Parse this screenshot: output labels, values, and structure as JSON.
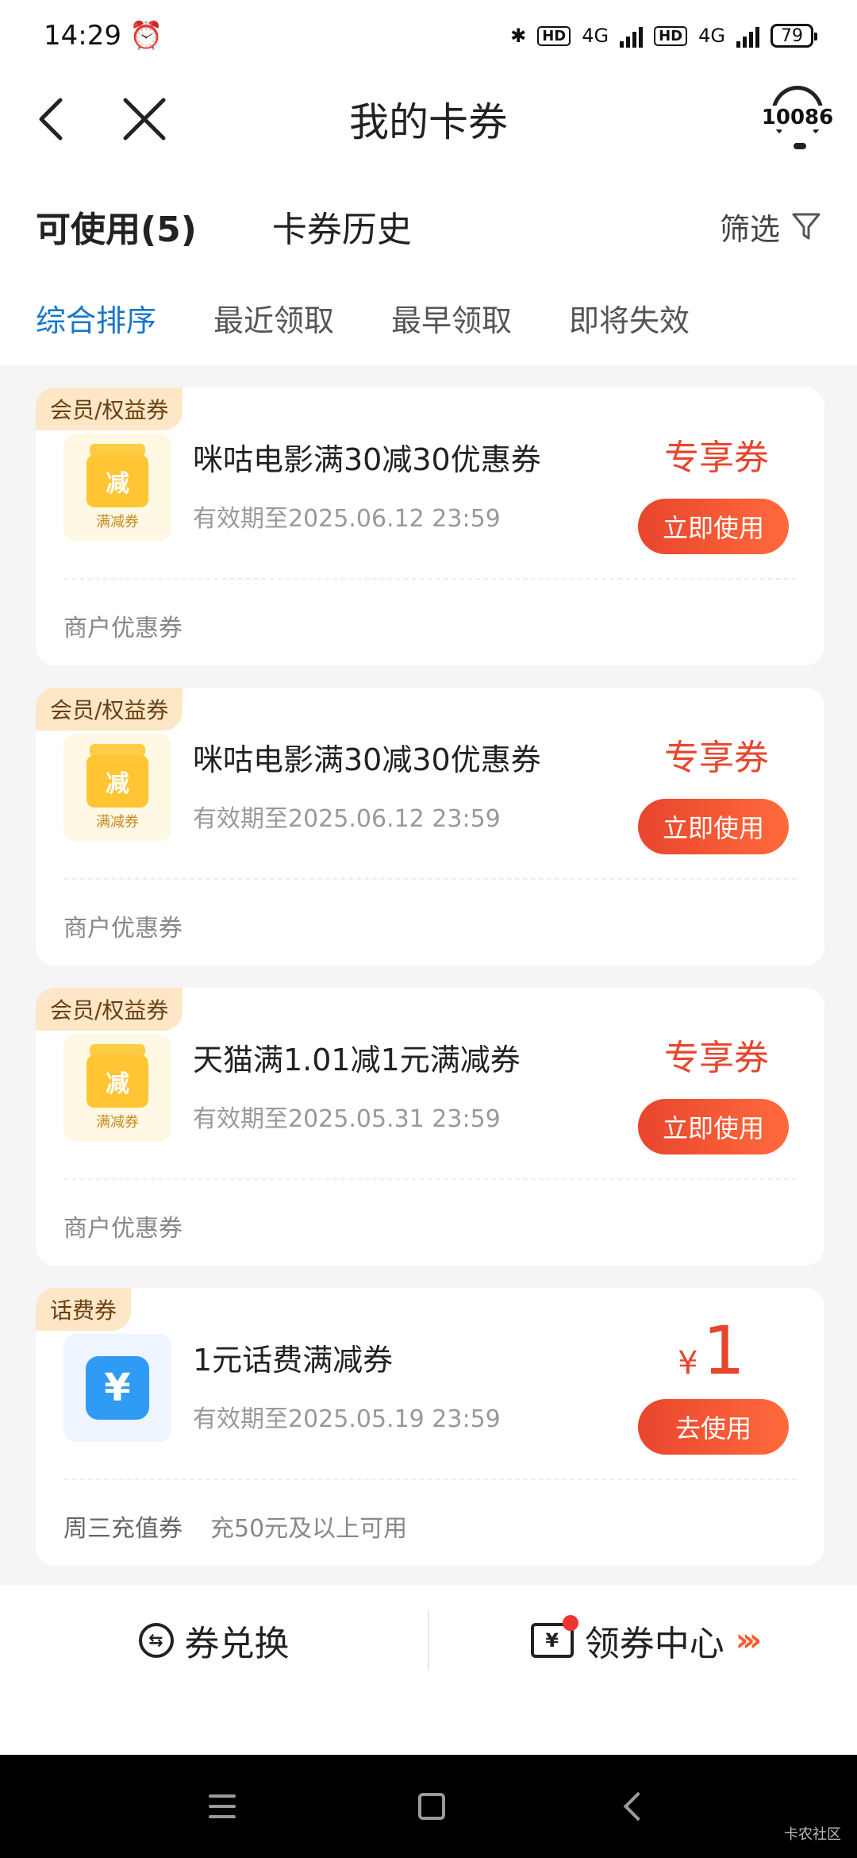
{
  "status_bar": {
    "time": "14:29",
    "network1": "4G",
    "network2": "4G",
    "hd": "HD",
    "battery": "79"
  },
  "header": {
    "title": "我的卡券",
    "service_label": "10086"
  },
  "tabs": [
    {
      "label": "可使用(5)",
      "active": true
    },
    {
      "label": "卡券历史",
      "active": false
    }
  ],
  "filter_label": "筛选",
  "sort_options": [
    {
      "label": "综合排序",
      "active": true
    },
    {
      "label": "最近领取",
      "active": false
    },
    {
      "label": "最早领取",
      "active": false
    },
    {
      "label": "即将失效",
      "active": false
    }
  ],
  "coupons": [
    {
      "tag": "会员/权益券",
      "icon_text": "减",
      "icon_caption": "满减券",
      "name": "咪咕电影满30减30优惠券",
      "expire": "有效期至2025.06.12 23:59",
      "badge": "专享券",
      "button": "立即使用",
      "footer": "商户优惠券"
    },
    {
      "tag": "会员/权益券",
      "icon_text": "减",
      "icon_caption": "满减券",
      "name": "咪咕电影满30减30优惠券",
      "expire": "有效期至2025.06.12 23:59",
      "badge": "专享券",
      "button": "立即使用",
      "footer": "商户优惠券"
    },
    {
      "tag": "会员/权益券",
      "icon_text": "减",
      "icon_caption": "满减券",
      "name": "天猫满1.01减1元满减券",
      "expire": "有效期至2025.05.31 23:59",
      "badge": "专享券",
      "button": "立即使用",
      "footer": "商户优惠券"
    },
    {
      "tag": "话费券",
      "icon_text": "¥",
      "name": "1元话费满减券",
      "expire": "有效期至2025.05.19 23:59",
      "currency": "¥",
      "amount": "1",
      "button": "去使用",
      "footer": "周三充值券",
      "footer_note": "充50元及以上可用"
    }
  ],
  "bottom_actions": {
    "exchange_icon": "⇆",
    "exchange": "券兑换",
    "center_icon": "¥",
    "center": "领券中心",
    "arrows": "›››"
  },
  "watermark": "卡农社区"
}
